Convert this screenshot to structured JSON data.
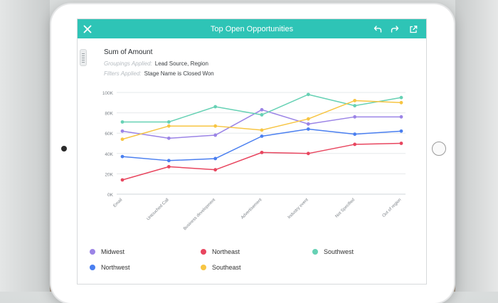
{
  "header": {
    "title": "Top Open Opportunities"
  },
  "report": {
    "title": "Sum of Amount",
    "grouping_key": "Groupings Applied:",
    "grouping_value": "Lead Source, Region",
    "filter_key": "Filters Applied:",
    "filter_value": "Stage Name is Closed Won"
  },
  "icons": {
    "close": "close-icon",
    "undo": "undo-icon",
    "redo": "redo-icon",
    "share": "share-icon"
  },
  "colors": {
    "header": "#2ec4b6"
  },
  "chart_data": {
    "type": "line",
    "categories": [
      "Email",
      "Untouched Call",
      "Business development",
      "Advertisement",
      "Industry event",
      "Not Specified",
      "Out of region"
    ],
    "ylim": [
      0,
      100
    ],
    "y_ticks": [
      "0K",
      "20K",
      "40K",
      "60K",
      "80K",
      "100K"
    ],
    "y_tick_values": [
      0,
      20,
      40,
      60,
      80,
      100
    ],
    "grid": true,
    "legend_position": "bottom",
    "series": [
      {
        "name": "Midwest",
        "color": "#9b84e6",
        "values": [
          62,
          55,
          58,
          83,
          69,
          76,
          76
        ]
      },
      {
        "name": "Northeast",
        "color": "#e8465f",
        "values": [
          14,
          27,
          24,
          41,
          40,
          49,
          50
        ]
      },
      {
        "name": "Southwest",
        "color": "#66d1b4",
        "values": [
          71,
          71,
          86,
          78,
          98,
          87,
          95
        ]
      },
      {
        "name": "Northwest",
        "color": "#4a7ff0",
        "values": [
          37,
          33,
          35,
          57,
          64,
          59,
          62
        ]
      },
      {
        "name": "Southeast",
        "color": "#f7c543",
        "values": [
          54,
          67,
          67,
          63,
          74,
          92,
          90
        ]
      }
    ]
  }
}
